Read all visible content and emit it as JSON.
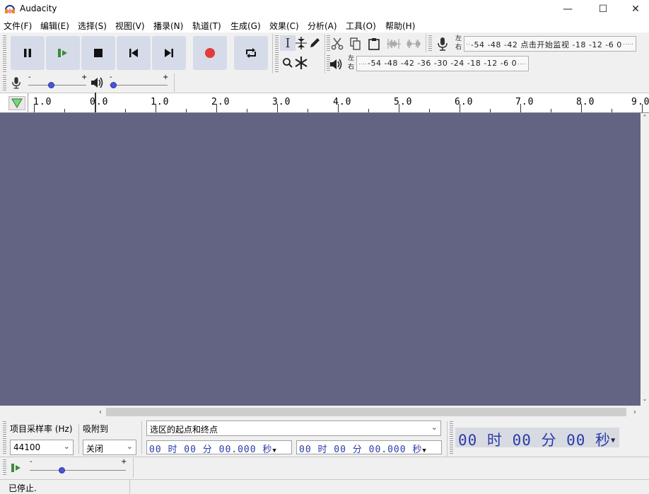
{
  "window": {
    "title": "Audacity",
    "minimize": "—",
    "maximize": "☐",
    "close": "✕"
  },
  "menu": [
    {
      "label": "文件(F)"
    },
    {
      "label": "编辑(E)"
    },
    {
      "label": "选择(S)"
    },
    {
      "label": "视图(V)"
    },
    {
      "label": "播录(N)"
    },
    {
      "label": "轨道(T)"
    },
    {
      "label": "生成(G)"
    },
    {
      "label": "效果(C)"
    },
    {
      "label": "分析(A)"
    },
    {
      "label": "工具(O)"
    },
    {
      "label": "帮助(H)"
    }
  ],
  "meters": {
    "rec_left": "左",
    "rec_right": "右",
    "rec_scale": "-54 -48 -42 点击开始监视 -18 -12 -6  0",
    "play_left": "左",
    "play_right": "右",
    "play_scale": "-54 -48 -42 -36 -30 -24 -18 -12 -6  0"
  },
  "ruler": {
    "labels": [
      "1.0",
      "0.0",
      "1.0",
      "2.0",
      "3.0",
      "4.0",
      "5.0",
      "6.0",
      "7.0",
      "8.0",
      "9.0"
    ]
  },
  "bottom": {
    "rate_label": "项目采样率 (Hz)",
    "snap_label": "吸附到",
    "rate_value": "44100",
    "snap_value": "关闭",
    "selection_mode": "选区的起点和终点",
    "sel_start": "00 时 00 分 00.000 秒",
    "sel_end": "00 时 00 分 00.000 秒",
    "audio_position": "00 时 00 分 00 秒"
  },
  "status": {
    "text": "已停止."
  },
  "colors": {
    "track_bg": "#636483",
    "record": "#e03c3c",
    "transport_bg": "#d5dbe8"
  }
}
